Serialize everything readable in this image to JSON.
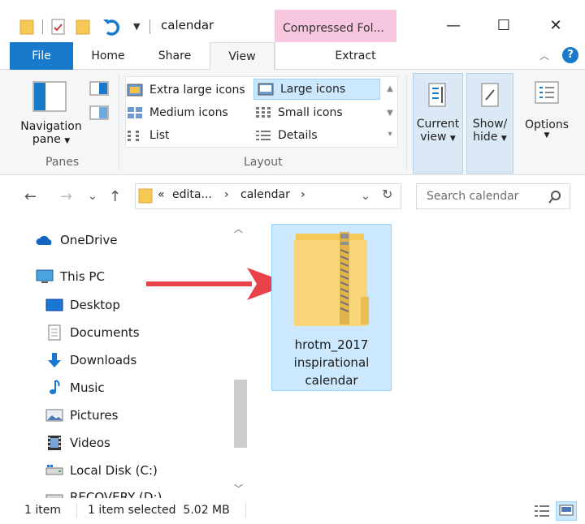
{
  "window": {
    "title": "calendar",
    "context_tab": "Compressed Fol...",
    "controls": {
      "minimize": "—",
      "maximize": "☐",
      "close": "✕"
    }
  },
  "ribbon": {
    "tabs": [
      "File",
      "Home",
      "Share",
      "View",
      "Extract"
    ],
    "active_tab": "View",
    "panes": {
      "navigation_label_1": "Navigation",
      "navigation_label_2": "pane",
      "group_label": "Panes"
    },
    "layout": {
      "group_label": "Layout",
      "options": [
        "Extra large icons",
        "Large icons",
        "Medium icons",
        "Small icons",
        "List",
        "Details"
      ],
      "selected": "Large icons"
    },
    "current_view": {
      "label_1": "Current",
      "label_2": "view"
    },
    "show_hide": {
      "label_1": "Show/",
      "label_2": "hide"
    },
    "options": {
      "label": "Options"
    }
  },
  "address_bar": {
    "back": "←",
    "forward": "→",
    "recent": "⌄",
    "up": "↑",
    "prefix": "«",
    "crumbs": [
      "edita...",
      "calendar"
    ],
    "separator": "›",
    "refresh": "↻"
  },
  "search": {
    "placeholder": "Search calendar"
  },
  "nav_pane": {
    "items": [
      "OneDrive",
      "This PC",
      "Desktop",
      "Documents",
      "Downloads",
      "Music",
      "Pictures",
      "Videos",
      "Local Disk (C:)",
      "RECOVERY (D:)"
    ]
  },
  "content": {
    "file": {
      "name_line_1": "hrotm_2017",
      "name_line_2": "inspirational",
      "name_line_3": "calendar",
      "icon": "zip-folder-icon"
    }
  },
  "status_bar": {
    "count": "1 item",
    "selection": "1 item selected  5.02 MB"
  },
  "colors": {
    "accent": "#1979ca",
    "selection": "#cce8ff",
    "arrow": "#e8424a",
    "context_tab": "#f7c6df"
  }
}
